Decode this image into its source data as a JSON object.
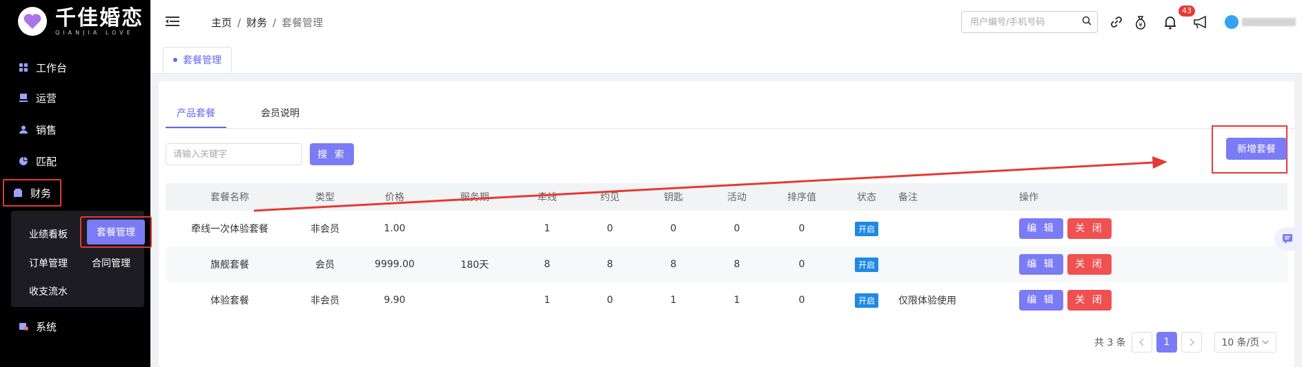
{
  "sidebar": {
    "logo_title": "千佳婚恋",
    "logo_subtitle": "QIANJIA LOVE",
    "items": [
      {
        "label": "工作台",
        "icon": "dashboard-icon"
      },
      {
        "label": "运营",
        "icon": "monitor-icon"
      },
      {
        "label": "销售",
        "icon": "user-icon"
      },
      {
        "label": "匹配",
        "icon": "pie-chart-icon"
      },
      {
        "label": "财务",
        "icon": "wallet-icon"
      },
      {
        "label": "系统",
        "icon": "settings-icon"
      }
    ],
    "finance_sub": [
      "业绩看板",
      "套餐管理",
      "订单管理",
      "合同管理",
      "收支流水"
    ]
  },
  "header": {
    "breadcrumb": [
      "主页",
      "财务",
      "套餐管理"
    ],
    "search_placeholder": "用户编号/手机号码",
    "notification_count": "43"
  },
  "tags": [
    "套餐管理"
  ],
  "tabs": [
    "产品套餐",
    "会员说明"
  ],
  "toolbar": {
    "keyword_placeholder": "请输入关键字",
    "search_label": "搜 索",
    "add_label": "新增套餐"
  },
  "table": {
    "columns": [
      "套餐名称",
      "类型",
      "价格",
      "服务期",
      "牵线",
      "约见",
      "钥匙",
      "活动",
      "排序值",
      "状态",
      "备注",
      "操作"
    ],
    "rows": [
      [
        "牵线一次体验套餐",
        "非会员",
        "1.00",
        "",
        "1",
        "0",
        "0",
        "0",
        "0",
        "开启",
        ""
      ],
      [
        "旗舰套餐",
        "会员",
        "9999.00",
        "180天",
        "8",
        "8",
        "8",
        "8",
        "0",
        "开启",
        ""
      ],
      [
        "体验套餐",
        "非会员",
        "9.90",
        "",
        "1",
        "0",
        "1",
        "1",
        "0",
        "开启",
        "仅限体验使用"
      ]
    ],
    "edit_label": "编 辑",
    "close_label": "关 闭"
  },
  "pagination": {
    "total": "共 3 条",
    "current_page": "1",
    "page_size": "10 条/页"
  },
  "colors": {
    "accent": "#7b7bf5",
    "danger": "#f05050",
    "status_blue": "#1e88e5",
    "annotation_red": "#e53935"
  }
}
